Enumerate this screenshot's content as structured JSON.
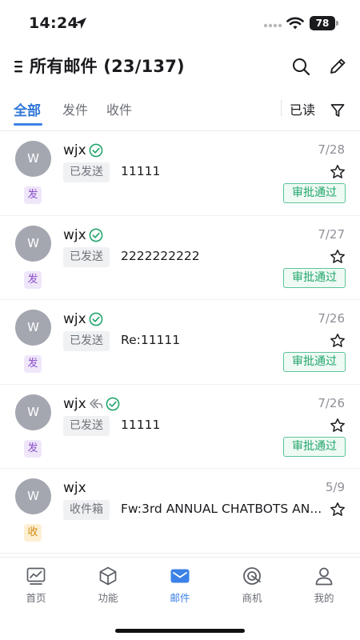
{
  "status_bar": {
    "time": "14:24",
    "battery": "78"
  },
  "header": {
    "title": "所有邮件 (23/137)"
  },
  "tabs": [
    {
      "label": "全部",
      "active": true
    },
    {
      "label": "发件",
      "active": false
    },
    {
      "label": "收件",
      "active": false
    }
  ],
  "read_filter": "已读",
  "mails": [
    {
      "avatar": "W",
      "sender": "wjx",
      "replied": false,
      "verified": true,
      "date": "7/28",
      "folder": "已发送",
      "subject": "11111",
      "kind": "发",
      "kind_style": "sent",
      "approval": "审批通过"
    },
    {
      "avatar": "W",
      "sender": "wjx",
      "replied": false,
      "verified": true,
      "date": "7/27",
      "folder": "已发送",
      "subject": "2222222222",
      "kind": "发",
      "kind_style": "sent",
      "approval": "审批通过"
    },
    {
      "avatar": "W",
      "sender": "wjx",
      "replied": false,
      "verified": true,
      "date": "7/26",
      "folder": "已发送",
      "subject": "Re:11111",
      "kind": "发",
      "kind_style": "sent",
      "approval": "审批通过"
    },
    {
      "avatar": "W",
      "sender": "wjx",
      "replied": true,
      "verified": true,
      "date": "7/26",
      "folder": "已发送",
      "subject": "11111",
      "kind": "发",
      "kind_style": "sent",
      "approval": "审批通过"
    },
    {
      "avatar": "W",
      "sender": "wjx",
      "replied": false,
      "verified": false,
      "date": "5/9",
      "folder": "收件箱",
      "subject": "Fw:3rd ANNUAL CHATBOTS AN...",
      "kind": "收",
      "kind_style": "inbox",
      "approval": ""
    }
  ],
  "bottom_nav": [
    {
      "label": "首页",
      "icon": "chart-monitor-icon",
      "active": false
    },
    {
      "label": "功能",
      "icon": "cube-icon",
      "active": false
    },
    {
      "label": "邮件",
      "icon": "mail-icon",
      "active": true
    },
    {
      "label": "商机",
      "icon": "radar-icon",
      "active": false
    },
    {
      "label": "我的",
      "icon": "person-icon",
      "active": false
    }
  ],
  "colors": {
    "accent": "#3b82e6",
    "approval_green": "#22a56c",
    "sent_purple": "#8b52c8",
    "inbox_orange": "#d38a14",
    "avatar_gray": "#a4a7b0"
  }
}
